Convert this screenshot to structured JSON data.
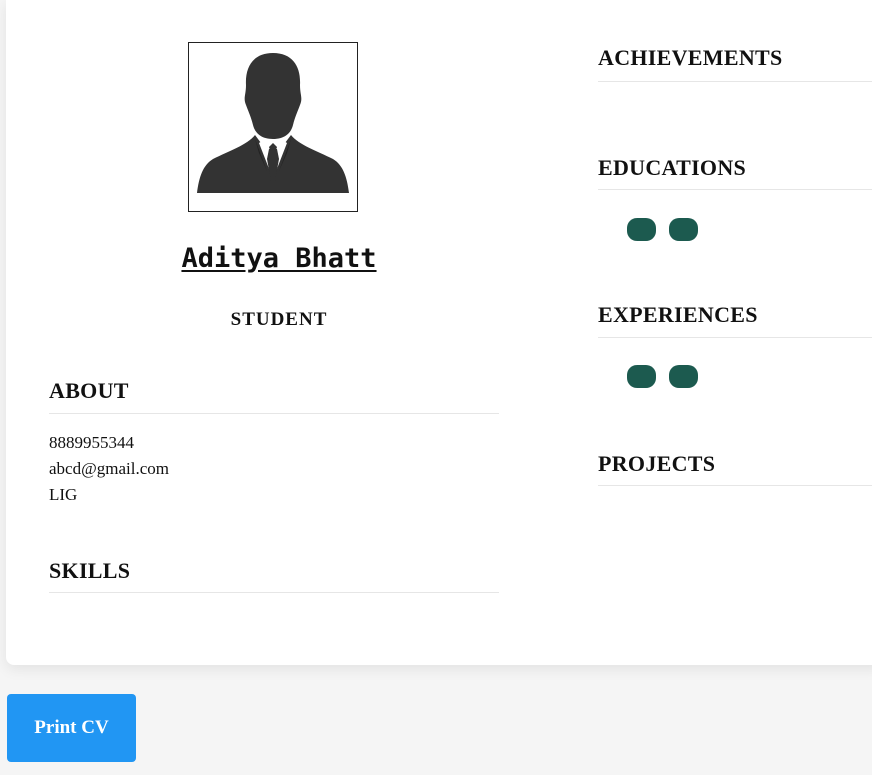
{
  "profile": {
    "name": "Aditya Bhatt",
    "role": "STUDENT",
    "photo_icon": "person-silhouette-icon"
  },
  "left": {
    "about_title": "ABOUT",
    "about_lines": [
      "8889955344",
      "abcd@gmail.com",
      "LIG"
    ],
    "skills_title": "SKILLS"
  },
  "right": {
    "achievements_title": "ACHIEVEMENTS",
    "educations_title": "EDUCATIONS",
    "experiences_title": "EXPERIENCES",
    "projects_title": "PROJECTS"
  },
  "actions": {
    "print_label": "Print CV"
  },
  "colors": {
    "pill": "#1c5a4f",
    "button": "#2196f3"
  }
}
